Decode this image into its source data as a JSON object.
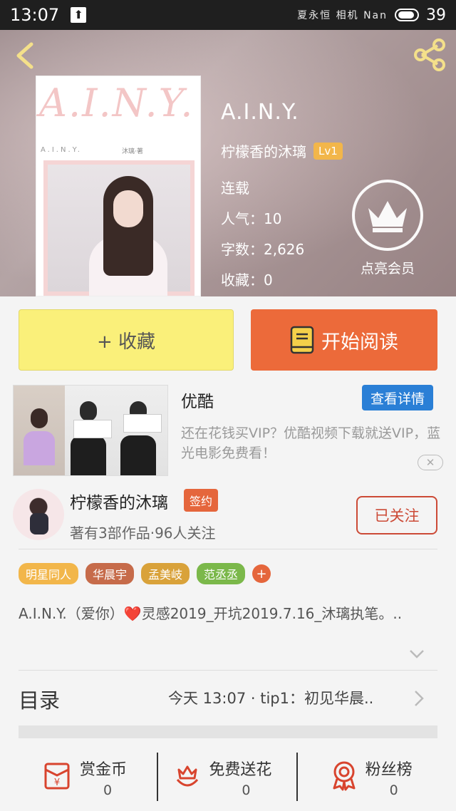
{
  "status_bar": {
    "time": "13:07",
    "battery": "39",
    "deco": "夏永恒 相机 Nan"
  },
  "book": {
    "title": "A.I.N.Y.",
    "cover_title": "A.I.N.Y.",
    "cover_subtitle": "A.I.N.Y.",
    "cover_author": "沐璃·著",
    "author": "柠檬香的沐璃",
    "level": "Lv1",
    "status": "连载",
    "popularity": "人气：10",
    "word_count": "字数：2,626",
    "favorites": "收藏：0",
    "vip_label": "点亮会员"
  },
  "actions": {
    "favorite": "+ 收藏",
    "read": "开始阅读"
  },
  "ad": {
    "name": "优酷",
    "detail_button": "查看详情",
    "description": "还在花钱买VIP？优酷视频下载就送VIP，蓝光电影免费看！",
    "close": "✕"
  },
  "author_box": {
    "name": "柠檬香的沐璃",
    "badge": "签约",
    "stats": "著有3部作品·96人关注",
    "follow_button": "已关注"
  },
  "tags": [
    {
      "label": "明星同人",
      "color": "#f2b64a"
    },
    {
      "label": "华晨宇",
      "color": "#c66b4a"
    },
    {
      "label": "孟美岐",
      "color": "#d9a23a"
    },
    {
      "label": "范丞丞",
      "color": "#7bb84a"
    }
  ],
  "tag_add": "+",
  "intro": {
    "text_before": "A.I.N.Y.（爱你）",
    "heart": "❤️",
    "text_after": "灵感2019_开坑2019.7.16_沐璃执笔。.."
  },
  "toc": {
    "label": "目录",
    "latest": "今天 13:07 · tip1：初见华晨.."
  },
  "bottom_bar": [
    {
      "label": "赏金币",
      "value": "0"
    },
    {
      "label": "免费送花",
      "value": "0"
    },
    {
      "label": "粉丝榜",
      "value": "0"
    }
  ],
  "colors": {
    "accent": "#ec6a3a",
    "favorite_bg": "#faf07a",
    "link_blue": "#2a7fd6",
    "follow_red": "#cc4a36"
  }
}
